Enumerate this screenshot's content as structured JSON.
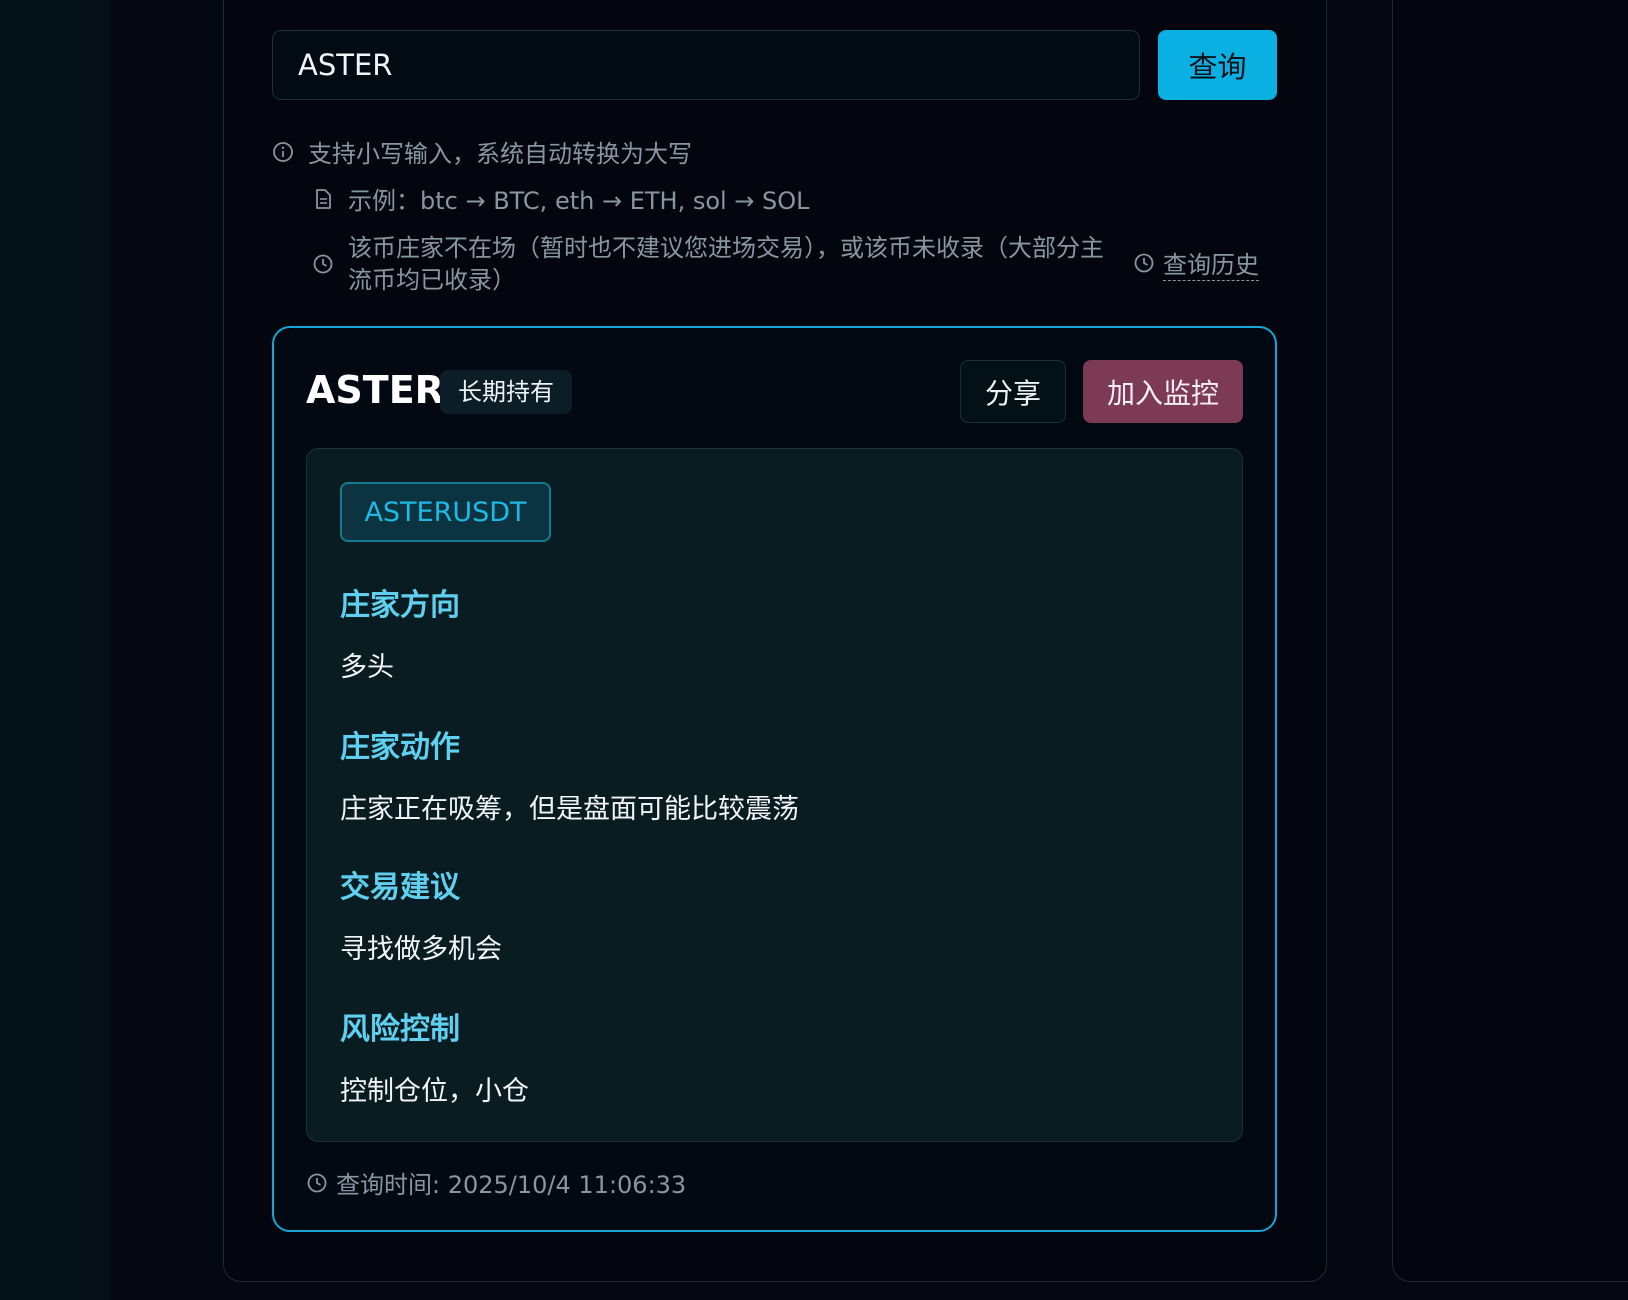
{
  "search": {
    "value": "ASTER",
    "button_label": "查询"
  },
  "hints": {
    "lowercase": "支持小写输入，系统自动转换为大写",
    "example": "示例：btc → BTC, eth → ETH, sol → SOL",
    "not_listed_line1": "该币庄家不在场（暂时也不建议您进场交易），或该币未收录（大部分主",
    "not_listed_line2": "流币均已收录）",
    "history_link": "查询历史"
  },
  "result": {
    "coin": "ASTER",
    "tag": "长期持有",
    "share_label": "分享",
    "monitor_label": "加入监控",
    "pair": "ASTERUSDT",
    "sections": [
      {
        "heading": "庄家方向",
        "value": "多头"
      },
      {
        "heading": "庄家动作",
        "value": "庄家正在吸筹，但是盘面可能比较震荡"
      },
      {
        "heading": "交易建议",
        "value": "寻找做多机会"
      },
      {
        "heading": "风险控制",
        "value": "控制仓位，小仓"
      }
    ],
    "query_time": "查询时间: 2025/10/4 11:06:33"
  },
  "icons": {
    "lowercase_hint": "info-icon",
    "example_hint": "document-icon",
    "not_listed_hint": "clock-icon",
    "history": "clock-icon",
    "query_time": "clock-icon"
  },
  "colors": {
    "accent": "#0bb0e2",
    "monitor_button": "#7d3a55",
    "section_heading": "#5fd0ef",
    "card_border": "#16a6d6"
  }
}
